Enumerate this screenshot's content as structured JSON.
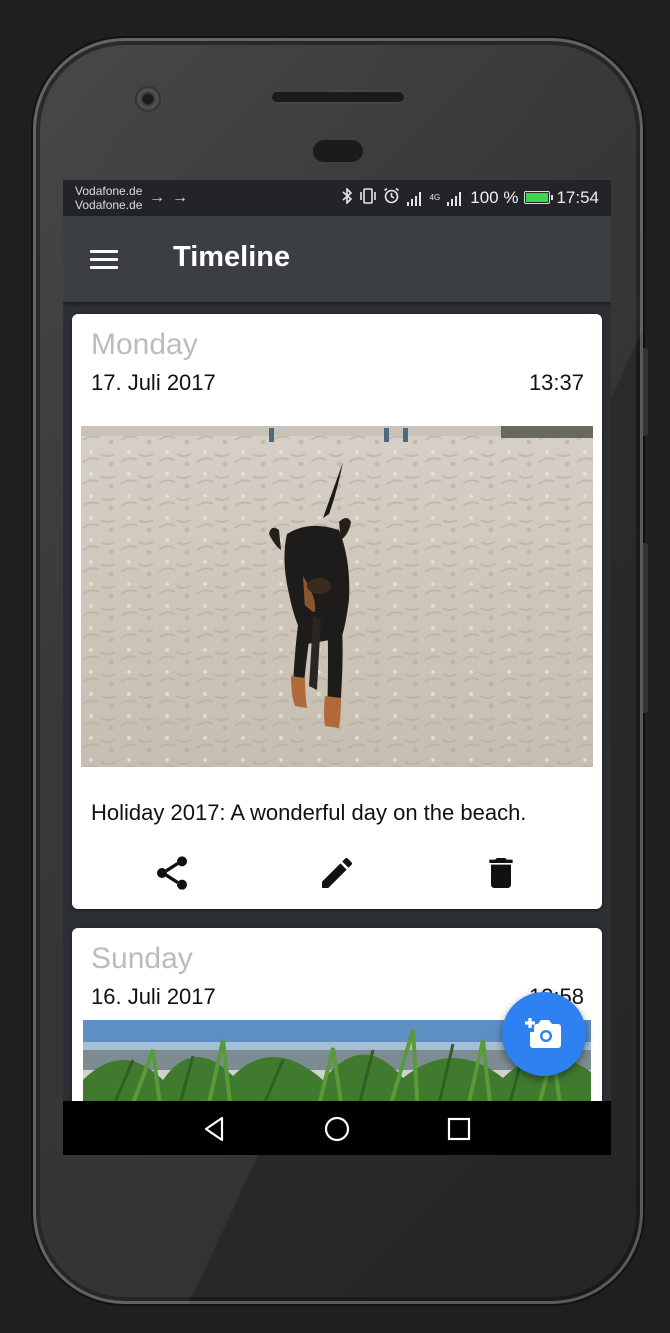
{
  "status_bar": {
    "carrier_line1": "Vodafone.de",
    "carrier_line2": "Vodafone.de",
    "network_label": "4G",
    "battery_percent": "100 %",
    "clock": "17:54",
    "icons": [
      "usb-icon",
      "usb-icon",
      "bluetooth-icon",
      "vibrate-icon",
      "alarm-icon",
      "signal-icon",
      "signal-icon",
      "battery-charging-icon"
    ],
    "battery_color": "#3fd44a"
  },
  "app_bar": {
    "title": "Timeline",
    "menu_icon": "hamburger-menu-icon",
    "background": "#3b3e43"
  },
  "entries": [
    {
      "day": "Monday",
      "date": "17. Juli 2017",
      "time": "13:37",
      "image": "photo of a black-and-tan dog walking on a sandy beach",
      "caption": "Holiday 2017: A wonderful day on the beach.",
      "actions": [
        "share-icon",
        "edit-icon",
        "delete-icon"
      ]
    },
    {
      "day": "Sunday",
      "date": "16. Juli 2017",
      "time": "13:58",
      "image": "photo of beach grass dunes by the sea"
    }
  ],
  "fab": {
    "icon": "add-photo-camera-icon",
    "color": "#2f80f0"
  },
  "nav_bar": {
    "icons": [
      "back-icon",
      "home-icon",
      "recents-icon"
    ]
  }
}
